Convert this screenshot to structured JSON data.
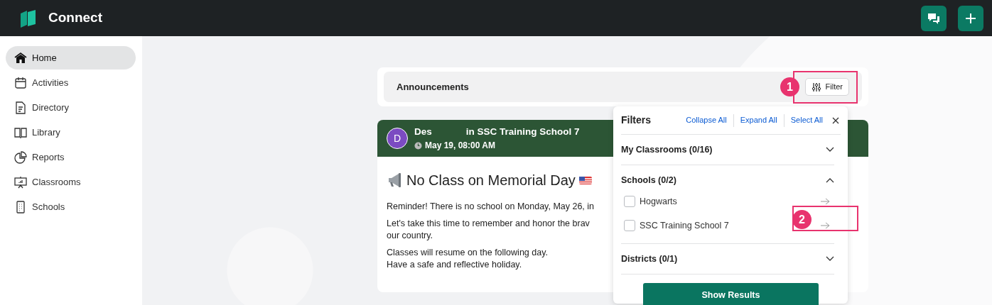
{
  "app": {
    "name": "Connect"
  },
  "header_actions": [
    {
      "kind": "chat"
    },
    {
      "kind": "add"
    }
  ],
  "sidebar": {
    "items": [
      {
        "label": "Home",
        "kind": "home",
        "selected": true
      },
      {
        "label": "Activities",
        "kind": "calendar",
        "selected": false
      },
      {
        "label": "Directory",
        "kind": "document",
        "selected": false
      },
      {
        "label": "Library",
        "kind": "book",
        "selected": false
      },
      {
        "label": "Reports",
        "kind": "pie",
        "selected": false
      },
      {
        "label": "Classrooms",
        "kind": "presentation",
        "selected": false
      },
      {
        "label": "Schools",
        "kind": "building",
        "selected": false
      }
    ]
  },
  "announcements": {
    "title": "Announcements",
    "filter_button": "Filter"
  },
  "post": {
    "avatar": "D",
    "author": "Des",
    "location": "in SSC Training School 7",
    "time": "May 19, 08:00 AM",
    "title": "No Class on Memorial Day",
    "paragraphs": [
      [
        "Reminder! There is no school on Monday, May 26, in"
      ],
      [
        "Let's take this time to remember and honor the brav",
        "our country."
      ],
      [
        "Classes will resume on the following day.",
        "Have a safe and reflective holiday."
      ]
    ]
  },
  "filters": {
    "title": "Filters",
    "actions": [
      "Collapse All",
      "Expand All",
      "Select All"
    ],
    "sections": [
      {
        "label": "My Classrooms (0/16)",
        "expanded": false
      },
      {
        "label": "Schools (0/2)",
        "expanded": true,
        "items": [
          {
            "label": "Hogwarts",
            "checked": false
          },
          {
            "label": "SSC Training School 7",
            "checked": false
          }
        ]
      },
      {
        "label": "Districts (0/1)",
        "expanded": false
      }
    ],
    "submit": "Show Results"
  },
  "annotations": [
    {
      "label": "1"
    },
    {
      "label": "2"
    }
  ]
}
